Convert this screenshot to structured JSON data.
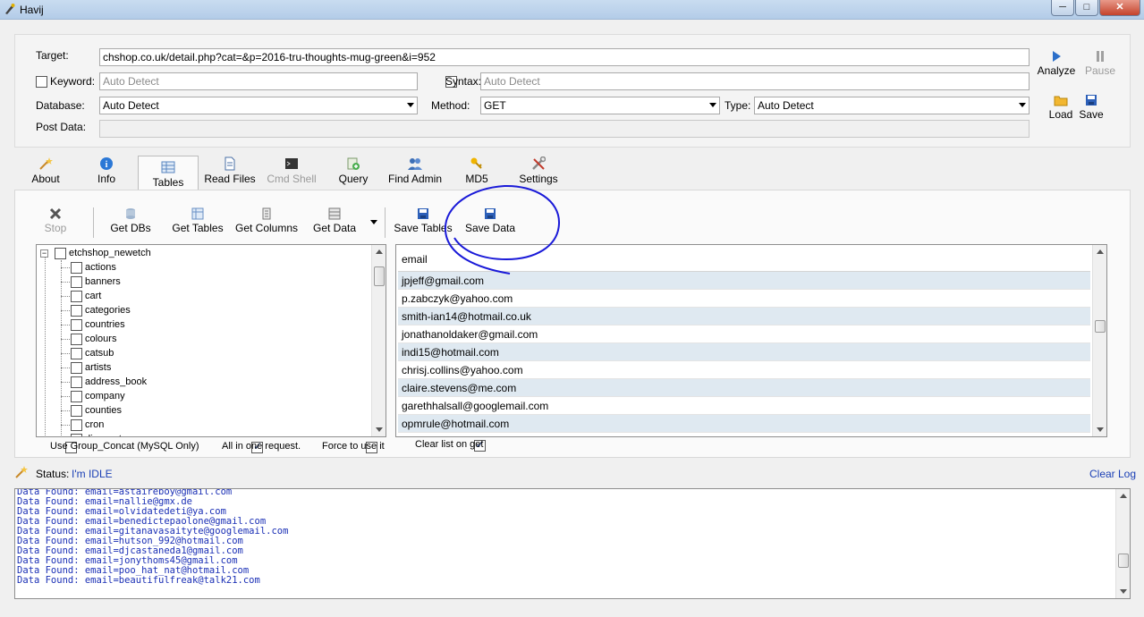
{
  "window": {
    "title": "Havij",
    "minimize": "─",
    "maximize": "□",
    "close": "✕"
  },
  "form": {
    "target_label": "Target:",
    "target_value": "chshop.co.uk/detail.php?cat=&p=2016-tru-thoughts-mug-green&i=952",
    "keyword_label": "Keyword:",
    "keyword_placeholder": "Auto Detect",
    "syntax_label": "Syntax:",
    "syntax_placeholder": "Auto Detect",
    "database_label": "Database:",
    "database_value": "Auto Detect",
    "method_label": "Method:",
    "method_value": "GET",
    "type_label": "Type:",
    "type_value": "Auto Detect",
    "postdata_label": "Post Data:"
  },
  "actions": {
    "analyze": "Analyze",
    "pause": "Pause",
    "load": "Load",
    "save": "Save"
  },
  "tabs": [
    {
      "label": "About",
      "icon": "wand-icon"
    },
    {
      "label": "Info",
      "icon": "info-icon"
    },
    {
      "label": "Tables",
      "icon": "table-icon"
    },
    {
      "label": "Read Files",
      "icon": "document-icon"
    },
    {
      "label": "Cmd Shell",
      "icon": "terminal-icon"
    },
    {
      "label": "Query",
      "icon": "query-icon"
    },
    {
      "label": "Find Admin",
      "icon": "users-icon"
    },
    {
      "label": "MD5",
      "icon": "key-icon"
    },
    {
      "label": "Settings",
      "icon": "tools-icon"
    }
  ],
  "toolbar": {
    "stop": "Stop",
    "get_dbs": "Get DBs",
    "get_tables": "Get Tables",
    "get_columns": "Get Columns",
    "get_data": "Get Data",
    "save_tables": "Save Tables",
    "save_data": "Save Data"
  },
  "tree": {
    "root": "etchshop_newetch",
    "items": [
      "actions",
      "banners",
      "cart",
      "categories",
      "countries",
      "colours",
      "catsub",
      "artists",
      "address_book",
      "company",
      "counties",
      "cron",
      "discounts"
    ]
  },
  "options": {
    "group_concat": "Use Group_Concat (MySQL Only)",
    "all_in_one": "All in one request.",
    "force": "Force to use it",
    "clear_list": "Clear list on get"
  },
  "grid": {
    "column": "email",
    "rows": [
      "jpjeff@gmail.com",
      "p.zabczyk@yahoo.com",
      "smith-ian14@hotmail.co.uk",
      "jonathanoldaker@gmail.com",
      "indi15@hotmail.com",
      "chrisj.collins@yahoo.com",
      "claire.stevens@me.com",
      "garethhalsall@googlemail.com",
      "opmrule@hotmail.com"
    ]
  },
  "status": {
    "label": "Status:",
    "value": "I'm IDLE",
    "clear_log": "Clear Log"
  },
  "log": [
    "Data Found: email=astaireboy@gmail.com",
    "Data Found: email=nallie@gmx.de",
    "Data Found: email=olvidatedeti@ya.com",
    "Data Found: email=benedictepaolone@gmail.com",
    "Data Found: email=gitanavasaityte@googlemail.com",
    "Data Found: email=hutson_992@hotmail.com",
    "Data Found: email=djcastaneda1@gmail.com",
    "Data Found: email=jonythoms45@gmail.com",
    "Data Found: email=poo_hat_nat@hotmail.com",
    "Data Found: email=beautifulfreak@talk21.com"
  ],
  "colors": {
    "annotation": "#1a1ad8",
    "row_alt": "#dfe9f1",
    "log_text": "#1a2fb5"
  }
}
